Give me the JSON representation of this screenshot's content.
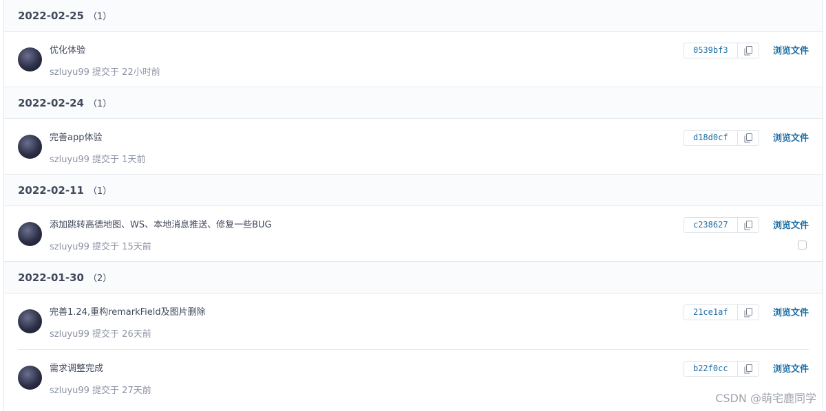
{
  "groups": [
    {
      "date": "2022-02-25",
      "count": "（1）",
      "commits": [
        {
          "title": "优化体验",
          "meta": "szluyu99 提交于 22小时前",
          "sha": "0539bf3",
          "browse": "浏览文件",
          "checkbox": false
        }
      ]
    },
    {
      "date": "2022-02-24",
      "count": "（1）",
      "commits": [
        {
          "title": "完善app体验",
          "meta": "szluyu99 提交于 1天前",
          "sha": "d18d0cf",
          "browse": "浏览文件",
          "checkbox": false
        }
      ]
    },
    {
      "date": "2022-02-11",
      "count": "（1）",
      "commits": [
        {
          "title": "添加跳转高德地图、WS、本地消息推送、修复一些BUG",
          "meta": "szluyu99 提交于 15天前",
          "sha": "c238627",
          "browse": "浏览文件",
          "checkbox": true
        }
      ]
    },
    {
      "date": "2022-01-30",
      "count": "（2）",
      "commits": [
        {
          "title": "完善1.24,重构remarkField及图片删除",
          "meta": "szluyu99 提交于 26天前",
          "sha": "21ce1af",
          "browse": "浏览文件",
          "checkbox": false
        },
        {
          "title": "需求调整完成",
          "meta": "szluyu99 提交于 27天前",
          "sha": "b22f0cc",
          "browse": "浏览文件",
          "checkbox": false
        }
      ]
    }
  ],
  "watermark": "CSDN @萌宅鹿同学",
  "icons": {
    "copy": "copy-icon",
    "checkbox": "checkbox-icon"
  },
  "colors": {
    "link": "#1d6fa5",
    "muted": "#8c92a4",
    "header_bg": "#fafbfc",
    "border": "#e3e9ed"
  }
}
